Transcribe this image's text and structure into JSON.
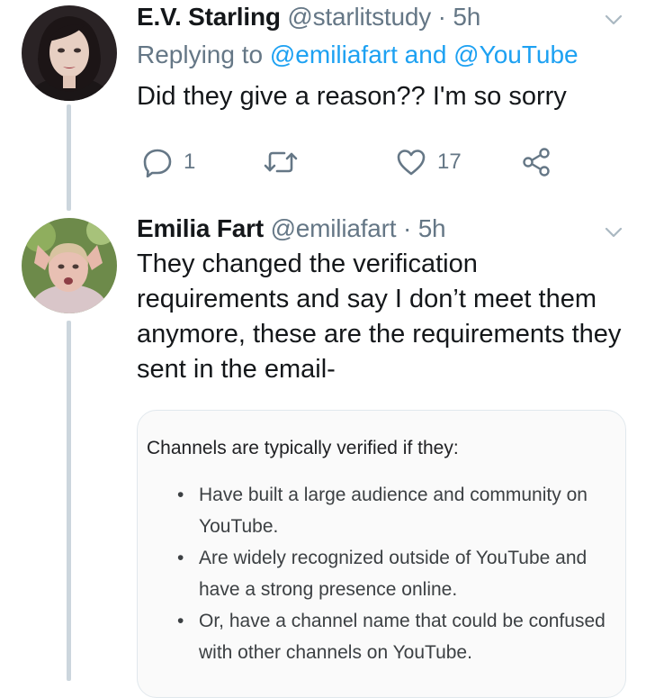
{
  "tweet1": {
    "name": "E.V. Starling",
    "handle": "@starlitstudy",
    "separator": "·",
    "time": "5h",
    "replying_prefix": "Replying to",
    "replying_mention1": "@emiliafart",
    "replying_and": "and",
    "replying_mention2": "@YouTube",
    "text": "Did they give a reason?? I'm so sorry",
    "replies": "1",
    "likes": "17"
  },
  "tweet2": {
    "name": "Emilia Fart",
    "handle": "@emiliafart",
    "separator": "·",
    "time": "5h",
    "text": "They changed the verification requirements and say I don’t meet them anymore, these are the requirements they sent in the email-",
    "card": {
      "title": "Channels are typically verified if they:",
      "bullet": "•",
      "items": [
        "Have built a large audience and community on YouTube.",
        "Are widely recognized outside of YouTube and have a strong presence online.",
        "Or, have a channel name that could be confused with other channels on YouTube."
      ]
    }
  },
  "colors": {
    "accent": "#1da1f2",
    "secondary_text": "#657786",
    "thread_line": "#ccd6dd"
  },
  "icons": {
    "reply": "speech-bubble",
    "retweet": "retweet-arrows",
    "like": "heart-outline",
    "share": "share-nodes",
    "menu": "chevron-down"
  }
}
